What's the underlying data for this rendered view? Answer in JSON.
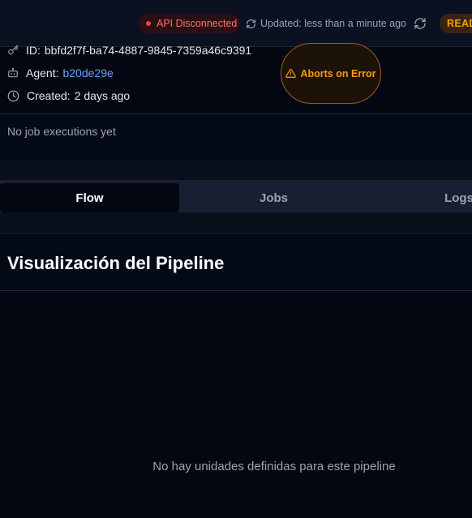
{
  "status_bar": {
    "api_status": "API Disconnected",
    "updated_text": "Updated: less than a minute ago",
    "ready_label": "READY",
    "colors": {
      "error": "#ef4444",
      "warning": "#f59e0b"
    }
  },
  "job_info": {
    "id_label": "ID:",
    "id_value": "bbfd2f7f-ba74-4887-9845-7359a46c9391",
    "agent_label": "Agent:",
    "agent_value": "b20de29e",
    "created_label": "Created:",
    "created_value": "2 days ago",
    "abort_badge": "Aborts on Error"
  },
  "executions": {
    "empty_text": "No job executions yet"
  },
  "tabs": [
    {
      "label": "Flow",
      "active": true
    },
    {
      "label": "Jobs",
      "active": false
    },
    {
      "label": "Logs",
      "active": false
    }
  ],
  "pipeline_view": {
    "title": "Visualización del Pipeline",
    "empty_text": "No hay unidades definidas para este pipeline"
  },
  "icons": [
    "key-icon",
    "bot-icon",
    "clock-icon",
    "refresh-icon",
    "warning-icon"
  ]
}
